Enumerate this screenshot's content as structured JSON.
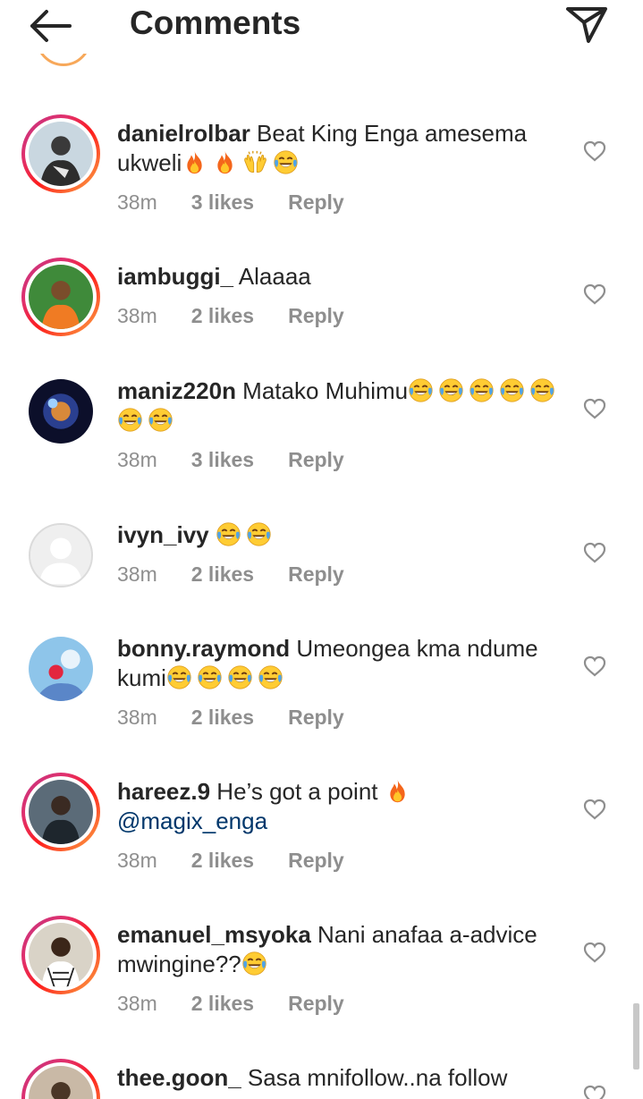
{
  "header": {
    "title": "Comments"
  },
  "comments": [
    {
      "username": "danielrolbar",
      "text": " Beat King Enga amesema ukweli",
      "emojis": [
        "fire",
        "fire",
        "raising-hands",
        "tears-of-joy"
      ],
      "time": "38m",
      "likes": "3 likes",
      "reply": "Reply"
    },
    {
      "username": "iambuggi_",
      "text": " Alaaaa",
      "time": "38m",
      "likes": "2 likes",
      "reply": "Reply"
    },
    {
      "username": "maniz220n",
      "text": " Matako Muhimu",
      "emojis": [
        "tears-of-joy",
        "tears-of-joy",
        "tears-of-joy",
        "tears-of-joy",
        "tears-of-joy",
        "tears-of-joy",
        "tears-of-joy"
      ],
      "time": "38m",
      "likes": "3 likes",
      "reply": "Reply"
    },
    {
      "username": "ivyn_ivy",
      "emojis": [
        "tears-of-joy",
        "tears-of-joy"
      ],
      "time": "38m",
      "likes": "2 likes",
      "reply": "Reply"
    },
    {
      "username": "bonny.raymond",
      "text": " Umeongea kma ndume kumi",
      "emojis": [
        "tears-of-joy",
        "tears-of-joy",
        "tears-of-joy",
        "tears-of-joy"
      ],
      "time": "38m",
      "likes": "2 likes",
      "reply": "Reply"
    },
    {
      "username": "hareez.9",
      "text": " He’s got a point ",
      "emojis": [
        "fire"
      ],
      "mention": "@magix_enga",
      "time": "38m",
      "likes": "2 likes",
      "reply": "Reply"
    },
    {
      "username": "emanuel_msyoka",
      "text": " Nani anafaa a-advice mwingine??",
      "emojis": [
        "tears-of-joy"
      ],
      "time": "38m",
      "likes": "2 likes",
      "reply": "Reply"
    },
    {
      "username": "thee.goon_",
      "text": " Sasa mnifollow..na follow"
    }
  ],
  "icons": {
    "back": "arrow-left-icon",
    "send": "paper-plane-icon",
    "like": "heart-outline-icon"
  },
  "colors": {
    "text": "#262626",
    "secondary": "#8e8e8e",
    "mention": "#00376b",
    "story_ring_start": "#c13584",
    "story_ring_end": "#fcaf45"
  }
}
